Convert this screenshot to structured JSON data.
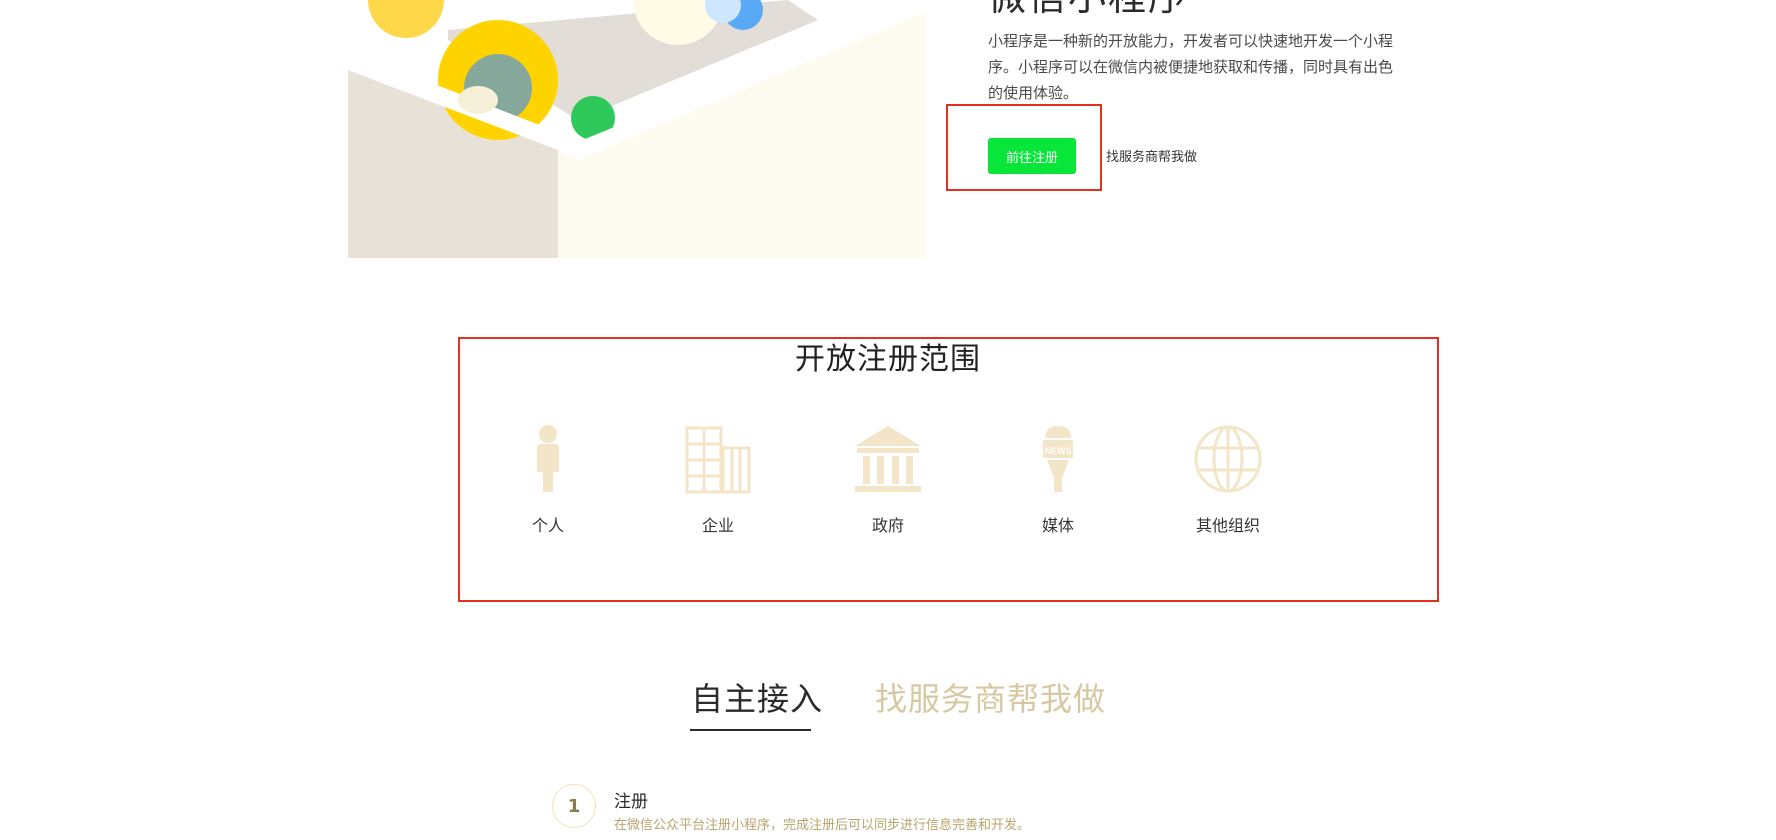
{
  "hero": {
    "title": "微信小程序",
    "description": "小程序是一种新的开放能力，开发者可以快速地开发一个小程序。小程序可以在微信内被便捷地获取和传播，同时具有出色的使用体验。",
    "register_button": "前往注册",
    "provider_link": "找服务商帮我做"
  },
  "scope": {
    "title": "开放注册范围",
    "items": [
      {
        "label": "个人",
        "icon": "person-icon"
      },
      {
        "label": "企业",
        "icon": "building-icon"
      },
      {
        "label": "政府",
        "icon": "government-icon"
      },
      {
        "label": "媒体",
        "icon": "media-microphone-icon"
      },
      {
        "label": "其他组织",
        "icon": "globe-icon"
      }
    ]
  },
  "tabs": {
    "self": "自主接入",
    "provider": "找服务商帮我做"
  },
  "steps": [
    {
      "number": "1",
      "title": "注册",
      "description": "在微信公众平台注册小程序，完成注册后可以同步进行信息完善和开发。"
    }
  ],
  "colors": {
    "accent_green": "#09e63a",
    "highlight_red": "#e2301d",
    "icon_beige": "#f3e6c8",
    "inactive_tab": "#d7c8a1"
  }
}
